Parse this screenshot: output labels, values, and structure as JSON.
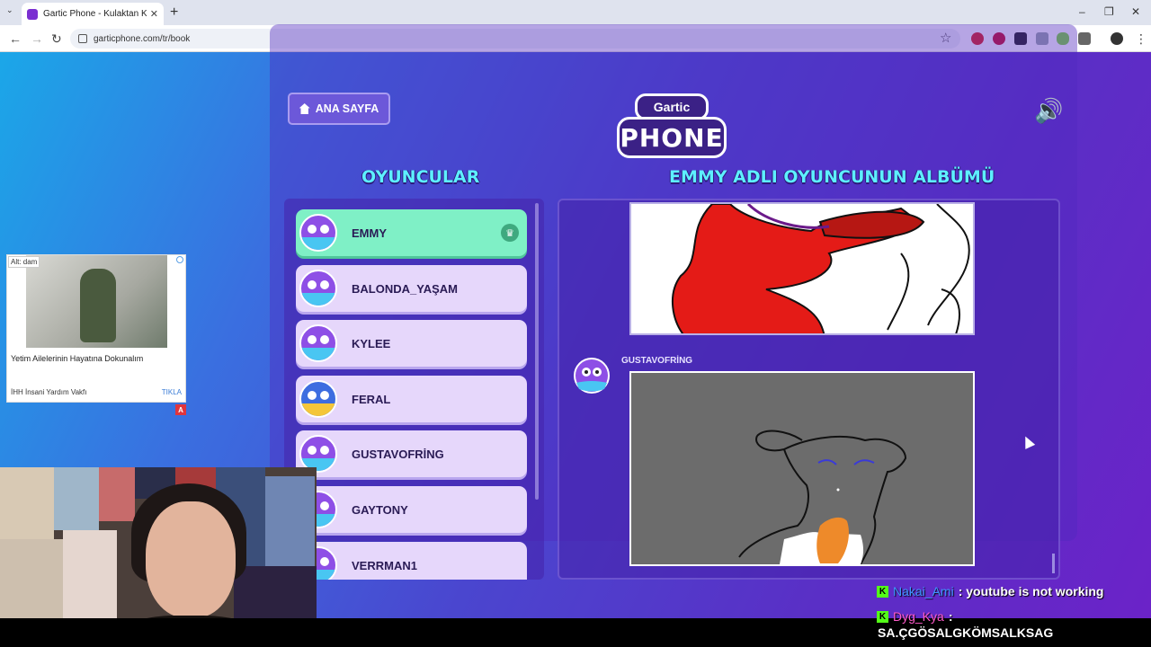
{
  "browser": {
    "tab_title": "Gartic Phone - Kulaktan Kulağa",
    "tab_close": "✕",
    "new_tab": "+",
    "tab_menu": "⌄",
    "url": "garticphone.com/tr/book",
    "back": "←",
    "forward": "→",
    "reload": "↻",
    "star": "☆",
    "minimize": "–",
    "restore": "❐",
    "close": "✕",
    "menu": "⋮"
  },
  "game": {
    "home_button": "ANA SAYFA",
    "logo_top": "Gartic",
    "logo_bottom": "PHONE",
    "speaker_icon": "🔊",
    "players_heading": "OYUNCULAR",
    "album_heading": "EMMY ADLI OYUNCUNUN ALBÜMÜ",
    "players": [
      {
        "name": "EMMY",
        "active": true,
        "crown": "♛"
      },
      {
        "name": "BALONDA_YAŞAM"
      },
      {
        "name": "KYLEE"
      },
      {
        "name": "FERAL"
      },
      {
        "name": "GUSTAVOFRİNG"
      },
      {
        "name": "GAYTONY"
      },
      {
        "name": "VERRMAN1"
      }
    ],
    "album_author": "GUSTAVOFRİNG"
  },
  "ad": {
    "tag": "Alt: dam",
    "headline": "Yetim Ailelerinin Hayatına Dokunalım",
    "sponsor": "İHH İnsani Yardım Vakfı",
    "cta": "TIKLA",
    "badge": "A"
  },
  "chat": {
    "badge": "K",
    "messages": [
      {
        "user": "Nakai_Ami",
        "text": " : youtube is not working"
      },
      {
        "user": "Dyg_Kya",
        "text": " :"
      }
    ],
    "bottom_text": "SA.ÇGÖSALGKÖMSALKSAG"
  },
  "colors": {
    "accent_cyan": "#5df0ff",
    "active_player": "#7ff0c6",
    "player_card": "#e6d7fb"
  }
}
